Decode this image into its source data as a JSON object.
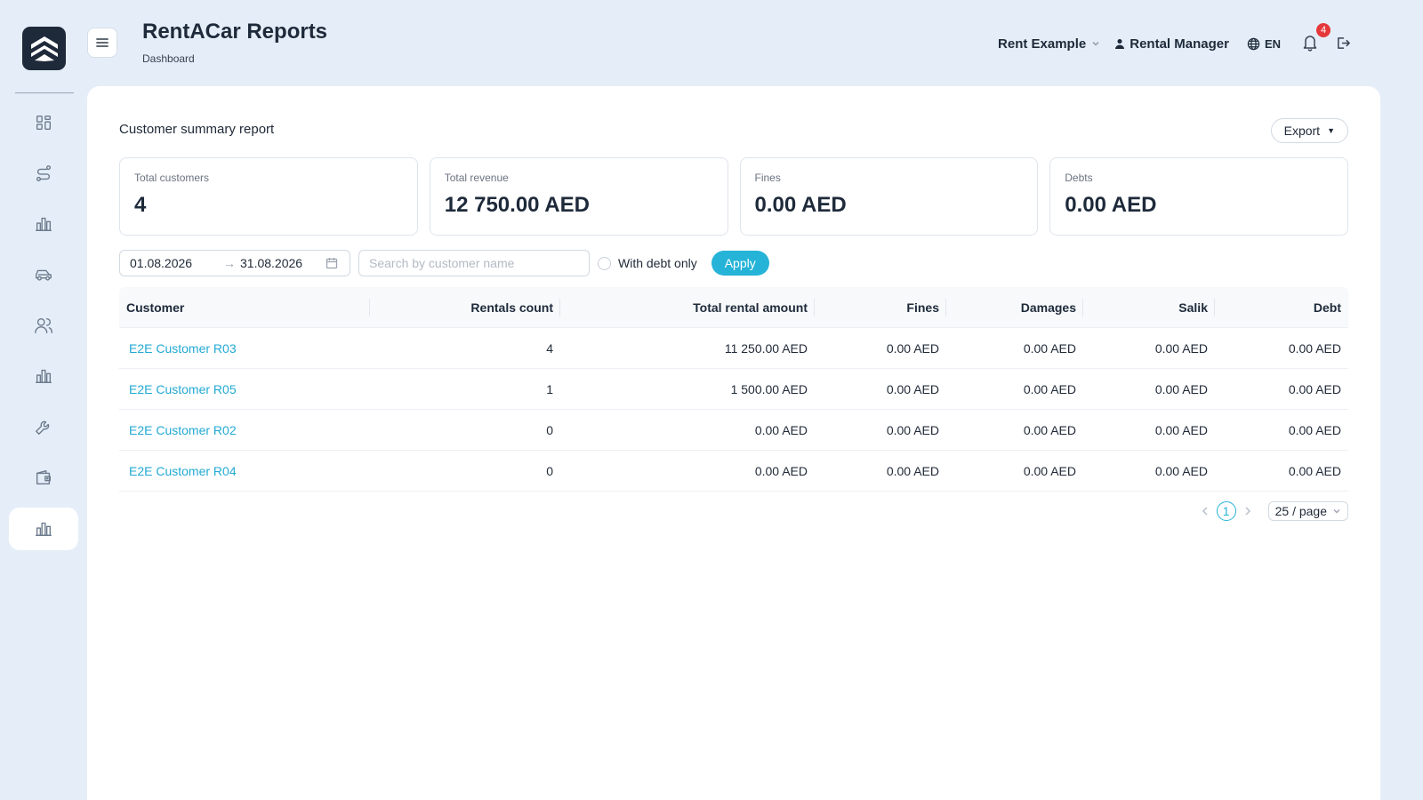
{
  "header": {
    "title": "RentACar Reports",
    "breadcrumb": "Dashboard",
    "company": "Rent Example",
    "user": "Rental Manager",
    "language": "EN",
    "notification_count": "4"
  },
  "sidebar": {
    "items": [
      {
        "icon": "dashboard-icon"
      },
      {
        "icon": "route-icon"
      },
      {
        "icon": "bar-chart-icon"
      },
      {
        "icon": "car-icon"
      },
      {
        "icon": "users-icon"
      },
      {
        "icon": "bar-chart-icon"
      },
      {
        "icon": "wrench-icon"
      },
      {
        "icon": "wallet-icon"
      },
      {
        "icon": "reports-chart-icon",
        "active": true
      }
    ]
  },
  "report": {
    "title": "Customer summary report",
    "export_label": "Export"
  },
  "stats": [
    {
      "label": "Total customers",
      "value": "4"
    },
    {
      "label": "Total revenue",
      "value": "12 750.00 AED"
    },
    {
      "label": "Fines",
      "value": "0.00 AED"
    },
    {
      "label": "Debts",
      "value": "0.00 AED"
    }
  ],
  "filters": {
    "date_start": "01.08.2026",
    "date_end": "31.08.2026",
    "search_placeholder": "Search by customer name",
    "search_value": "",
    "debt_only_label": "With debt only",
    "debt_only_checked": false,
    "apply_label": "Apply"
  },
  "table": {
    "columns": [
      "Customer",
      "Rentals count",
      "Total rental amount",
      "Fines",
      "Damages",
      "Salik",
      "Debt"
    ],
    "rows": [
      [
        "E2E Customer R03",
        "4",
        "11 250.00 AED",
        "0.00 AED",
        "0.00 AED",
        "0.00 AED",
        "0.00 AED"
      ],
      [
        "E2E Customer R05",
        "1",
        "1 500.00 AED",
        "0.00 AED",
        "0.00 AED",
        "0.00 AED",
        "0.00 AED"
      ],
      [
        "E2E Customer R02",
        "0",
        "0.00 AED",
        "0.00 AED",
        "0.00 AED",
        "0.00 AED",
        "0.00 AED"
      ],
      [
        "E2E Customer R04",
        "0",
        "0.00 AED",
        "0.00 AED",
        "0.00 AED",
        "0.00 AED",
        "0.00 AED"
      ]
    ]
  },
  "pagination": {
    "current_page": "1",
    "page_size": "25 / page"
  },
  "colors": {
    "accent": "#26b3d8",
    "background": "#e5eef8",
    "sidebar_logo": "#1e2a3a",
    "badge": "#e5383b"
  }
}
